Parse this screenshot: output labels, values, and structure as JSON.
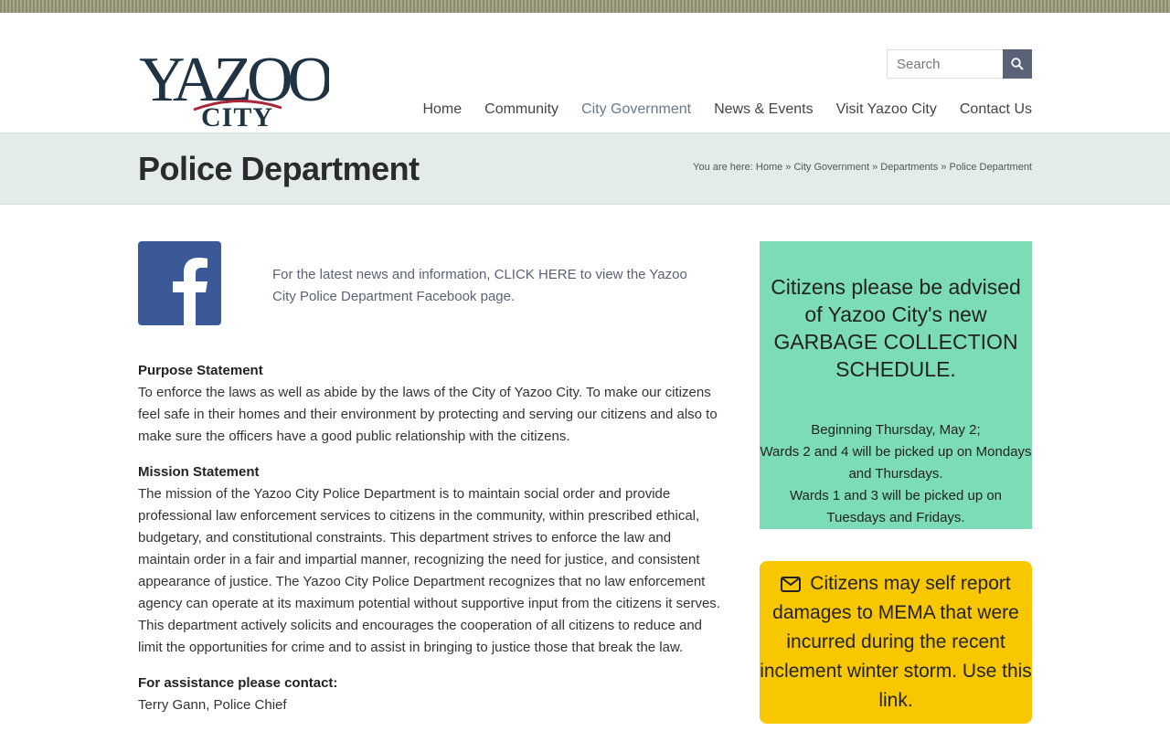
{
  "logo": {
    "line1": "YAZOO",
    "line2": "CITY"
  },
  "search": {
    "placeholder": "Search"
  },
  "nav": [
    {
      "label": "Home"
    },
    {
      "label": "Community"
    },
    {
      "label": "City Government"
    },
    {
      "label": "News & Events"
    },
    {
      "label": "Visit Yazoo City"
    },
    {
      "label": "Contact Us"
    }
  ],
  "page": {
    "title": "Police Department"
  },
  "breadcrumb": {
    "prefix": "You are here:",
    "items": [
      "Home",
      "City Government",
      "Departments",
      "Police Department"
    ],
    "sep": "»"
  },
  "facebook": {
    "text": "For the latest news and information, CLICK HERE to view the Yazoo City Police Department Facebook page."
  },
  "purpose": {
    "heading": "Purpose Statement",
    "body": "To enforce the laws as well as abide by the laws of the City of Yazoo City. To make our citizens feel safe in their homes and their environment by protecting and serving our citizens and also to make sure the officers have a good public relationship with the citizens."
  },
  "mission": {
    "heading": "Mission Statement",
    "body": "The mission of the Yazoo City Police Department is to maintain social order and provide professional law enforcement services to citizens in the community, within prescribed ethical, budgetary, and constitutional constraints. This department strives to enforce the law and maintain order in a fair and impartial manner, recognizing the need for justice, and consistent appearance of justice. The Yazoo City Police Department recognizes that no law enforcement agency can operate at its maximum potential without supportive input from the citizens it serves. This department actively solicits and encourages the cooperation of all citizens to reduce and limit the opportunities for crime and to assist in bringing to justice those that break the law."
  },
  "contact": {
    "heading": "For assistance please contact:",
    "name": "Terry Gann, Police Chief"
  },
  "notice_green": {
    "headline": "Citizens please be advised of Yazoo City's new GARBAGE COLLECTION SCHEDULE.",
    "line1": "Beginning Thursday, May 2;",
    "line2": "Wards 2 and 4 will be picked up on Mondays and Thursdays.",
    "line3": "Wards 1 and 3 will be picked up on Tuesdays and Fridays."
  },
  "notice_yellow": {
    "text": "Citizens may self report damages to MEMA that were incurred during the recent inclement winter storm. Use this link."
  },
  "colors": {
    "nav_active": "#6a7a8c",
    "green_box": "#7cdcb5",
    "yellow_box": "#f9c700",
    "facebook": "#3b5998"
  }
}
